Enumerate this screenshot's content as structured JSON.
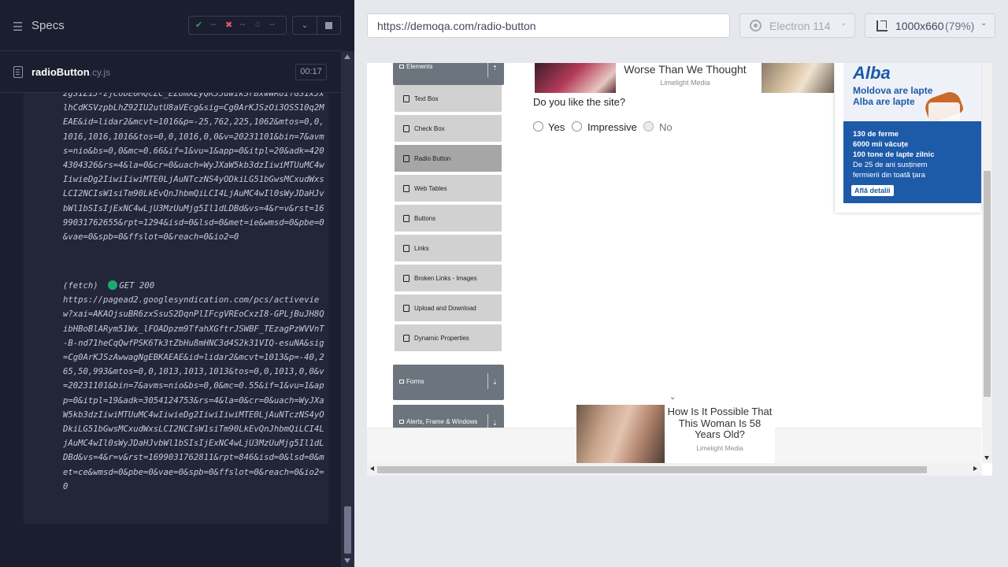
{
  "runner": {
    "specs_title": "Specs",
    "stats": {
      "passed": "--",
      "failed": "--",
      "pending": "--"
    },
    "spec_file": {
      "name": "radioButton",
      "ext": ".cy.js",
      "duration": "00:17"
    },
    "log": {
      "block1_text": "2gS1Z1J-zjCobE0MQcZC_EZUmXZyQK35uwikSrBxwWR6IfGS1xJxlhCdKSVzpbLhZ92IU2utU8aVEcg&sig=Cg0ArKJSzOi3OSS10q2MEAE&id=lidar2&mcvt=1016&p=-25,762,225,1062&mtos=0,0,1016,1016,1016&tos=0,0,1016,0,0&v=20231101&bin=7&avms=nio&bs=0,0&mc=0.66&if=1&vu=1&app=0&itpl=20&adk=4204304326&rs=4&la=0&cr=0&uach=WyJXaW5kb3dzIiwiMTUuMC4wIiwieDg2IiwiIiwiMTE0LjAuNTczNS4yODkiLG51bGwsMCxudWxsLCI2NCIsW1siTm90LkEvQnJhbmQiLCI4LjAuMC4wIl0sWyJDaHJvbWl1bSIsIjExNC4wLjU3MzUuMjg5Il1dLDBd&vs=4&r=v&rst=1699031762655&rpt=1294&isd=0&lsd=0&met=ie&wmsd=0&pbe=0&vae=0&spb=0&ffslot=0&reach=0&io2=0",
      "fetch_label": "(fetch)",
      "fetch_status": "GET 200",
      "block2_url": "https://pagead2.googlesyndication.com/pcs/activeview?xai=AKAOjsuBR6zxSsuS2DqnPlIFcgVREoCxzI8-GPLjBuJH8QibHBoBlARym51Wx_lFOADpzm9TfahXGftrJSWBF_TEzagPzWVVnT-B-nd71heCqQwfPSK6Tk3tZbHu8mHNC3d4S2k31VIQ-esuNA&sig=Cg0ArKJSzAwwagNgEBKAEAE&id=lidar2&mcvt=1013&p=-40,265,50,993&mtos=0,0,1013,1013,1013&tos=0,0,1013,0,0&v=20231101&bin=7&avms=nio&bs=0,0&mc=0.55&if=1&vu=1&app=0&itpl=19&adk=3054124753&rs=4&la=0&cr=0&uach=WyJXaW5kb3dzIiwiMTUuMC4wIiwieDg2IiwiIiwiMTE0LjAuNTczNS4yODkiLG51bGwsMCxudWxsLCI2NCIsW1siTm90LkEvQnJhbmQiLCI4LjAuMC4wIl0sWyJDaHJvbWl1bSIsIjExNC4wLjU3MzUuMjg5Il1dLDBd&vs=4&r=v&rst=1699031762811&rpt=846&isd=0&lsd=0&met=ce&wmsd=0&pbe=0&vae=0&spb=0&ffslot=0&reach=0&io2=0"
    }
  },
  "toolbar": {
    "url": "https://demoqa.com/radio-button",
    "browser": "Electron 114",
    "viewport_size": "1000x660",
    "viewport_zoom": "(79%)"
  },
  "aut": {
    "sidebar": {
      "elements_header": "Elements",
      "items": [
        "Text Box",
        "Check Box",
        "Radio Button",
        "Web Tables",
        "Buttons",
        "Links",
        "Broken Links - Images",
        "Upload and Download",
        "Dynamic Properties"
      ],
      "active_item": "Radio Button",
      "forms_header": "Forms",
      "alerts_header": "Alerts, Frame & Windows"
    },
    "top_ad": {
      "title": "Worse Than We Thought",
      "source": "Limelight Media"
    },
    "question": "Do you like the site?",
    "radios": [
      {
        "label": "Yes",
        "disabled": false
      },
      {
        "label": "Impressive",
        "disabled": false
      },
      {
        "label": "No",
        "disabled": true
      }
    ],
    "alba_ad": {
      "logo": "Alba",
      "headline_1": "Moldova are lapte",
      "headline_2": "Alba are lapte",
      "line_1": "130 de ferme",
      "line_2": "6000 mii văcuțe",
      "line_3": "100 tone de lapte zilnic",
      "line_4": "De 25 de ani susținem",
      "line_5": "fermierii din toată țara",
      "cta": "Află detalii"
    },
    "bottom_ad": {
      "title": "How Is It Possible That This Woman Is 58 Years Old?",
      "source": "Limelight Media"
    }
  },
  "colors": {
    "runner_bg": "#1b1e2e",
    "pass": "#1fa971",
    "fail": "#e45770",
    "sidebar_header": "#6c757d",
    "sidebar_item": "#d1d1d1",
    "sidebar_active": "#a6a6a6",
    "alba_blue": "#1d5aa8"
  }
}
